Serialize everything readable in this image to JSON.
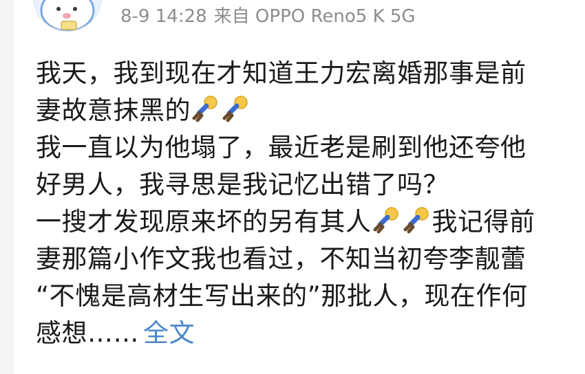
{
  "post": {
    "timestamp": "8-9 14:28",
    "source_label": "来自 OPPO Reno5 K 5G",
    "lines": [
      "我天，我到现在才知道王力宏离婚那事是前",
      "妻故意抹黑的",
      "我一直以为他塌了，最近老是刷到他还夸他",
      "好男人，我寻思是我记忆出错了吗？",
      "一搜才发现原来坏的另有其人",
      "我记得前",
      "妻那篇小作文我也看过，不知当初夸李靓蕾",
      "“不愧是高材生写出来的”那批人，现在作何",
      "感想"
    ],
    "ellipsis": "……",
    "full_text_link": "全文"
  },
  "icons": {
    "emoji": "falling-person-emoji",
    "avatar": "cartoon-avatar"
  },
  "colors": {
    "meta_gray": "#8c8c8c",
    "link_blue": "#4a86c8",
    "text": "#1a1a1a"
  }
}
